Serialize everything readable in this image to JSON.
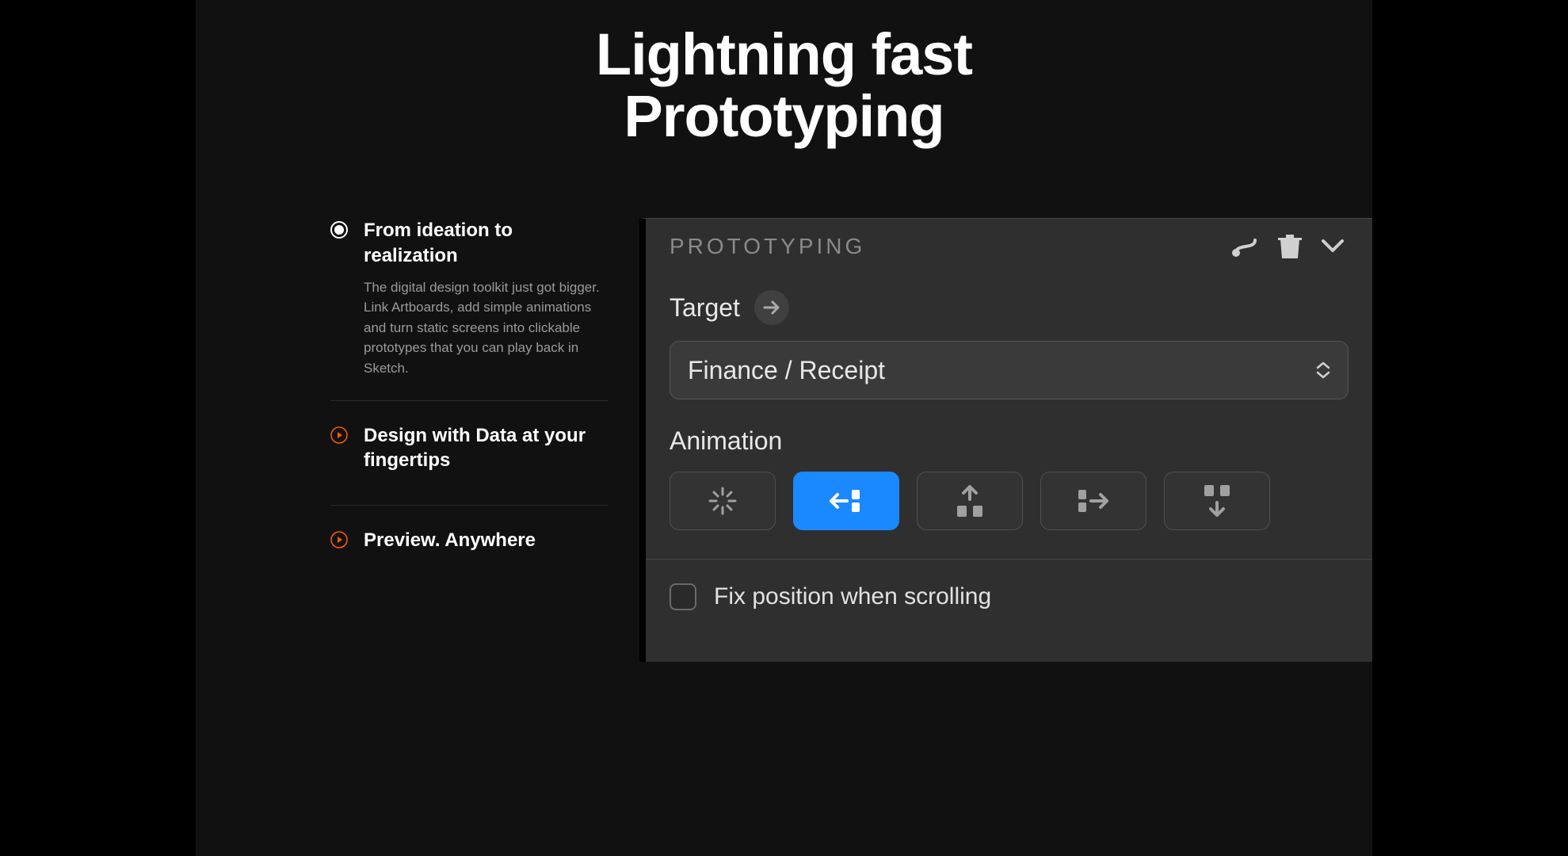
{
  "hero": {
    "line1": "Lightning fast",
    "line2": "Prototyping"
  },
  "features": [
    {
      "title": "From ideation to realization",
      "desc": "The digital design toolkit just got bigger. Link Artboards, add simple animations and turn static screens into clickable prototypes that you can play back in Sketch.",
      "active": true
    },
    {
      "title": "Design with Data at your fingertips",
      "desc": "",
      "active": false
    },
    {
      "title": "Preview. Anywhere",
      "desc": "",
      "active": false
    }
  ],
  "panel": {
    "title": "PROTOTYPING",
    "target_label": "Target",
    "target_value": "Finance / Receipt",
    "animation_label": "Animation",
    "animations": [
      {
        "name": "none",
        "selected": false
      },
      {
        "name": "slide-left",
        "selected": true
      },
      {
        "name": "slide-up",
        "selected": false
      },
      {
        "name": "slide-right",
        "selected": false
      },
      {
        "name": "slide-down",
        "selected": false
      }
    ],
    "fix_position_label": "Fix position when scrolling",
    "fix_position_checked": false
  },
  "colors": {
    "accent_orange": "#ff5a00",
    "accent_blue": "#1a88ff"
  }
}
